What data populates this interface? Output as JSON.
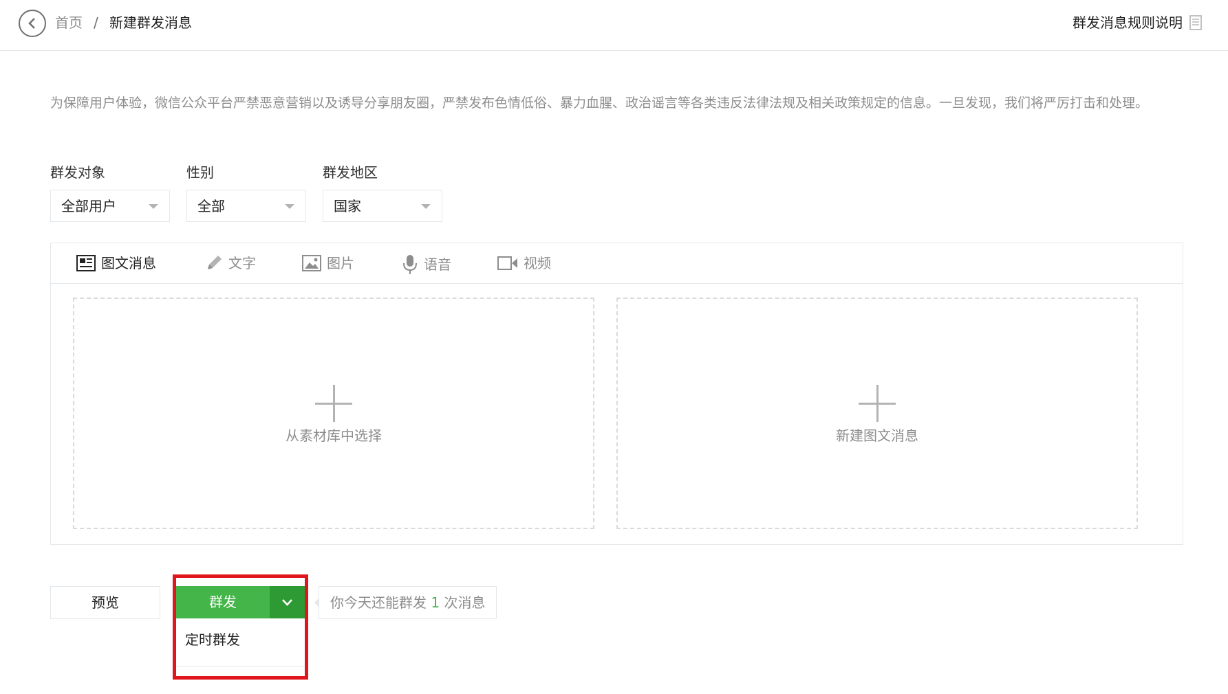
{
  "header": {
    "back_icon": "chevron-left-circle-icon",
    "breadcrumb": {
      "home": "首页",
      "separator": "/",
      "current": "新建群发消息"
    },
    "rules_link": "群发消息规则说明",
    "rules_icon": "document-icon"
  },
  "notice": "为保障用户体验，微信公众平台严禁恶意营销以及诱导分享朋友圈，严禁发布色情低俗、暴力血腥、政治谣言等各类违反法律法规及相关政策规定的信息。一旦发现，我们将严厉打击和处理。",
  "filters": {
    "audience": {
      "label": "群发对象",
      "value": "全部用户"
    },
    "gender": {
      "label": "性别",
      "value": "全部"
    },
    "region": {
      "label": "群发地区",
      "value": "国家"
    }
  },
  "tabs": [
    {
      "label": "图文消息",
      "icon": "news-icon",
      "active": true
    },
    {
      "label": "文字",
      "icon": "pencil-icon"
    },
    {
      "label": "图片",
      "icon": "image-icon"
    },
    {
      "label": "语音",
      "icon": "microphone-icon"
    },
    {
      "label": "视频",
      "icon": "video-icon"
    }
  ],
  "cards": {
    "library": "从素材库中选择",
    "new": "新建图文消息"
  },
  "actions": {
    "preview": "预览",
    "send": "群发",
    "dropdown_icon": "chevron-down-icon",
    "dropdown_items": [
      "定时群发"
    ],
    "quota_prefix": "你今天还能群发",
    "quota_count": "1",
    "quota_suffix": "次消息"
  },
  "colors": {
    "primary_green": "#44b549",
    "dark_green": "#2e9a34",
    "highlight_red": "#e0161d",
    "muted_text": "#8d8d8d",
    "border": "#e4e8eb"
  }
}
